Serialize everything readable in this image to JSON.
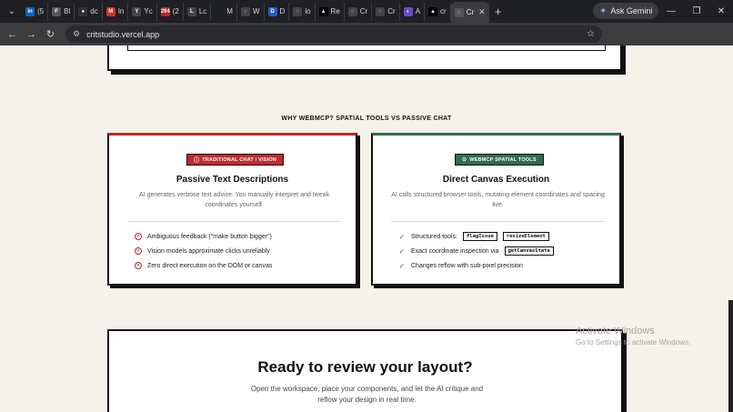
{
  "browser": {
    "tabs": [
      {
        "icon": "linkedin-icon",
        "glyph": "in",
        "color": "#0a66c2",
        "label": "(5"
      },
      {
        "icon": "page-icon",
        "glyph": "F",
        "color": "#555",
        "label": "Bl"
      },
      {
        "icon": "github-icon",
        "glyph": "●",
        "color": "#333",
        "label": "dc"
      },
      {
        "icon": "gmail-icon",
        "glyph": "M",
        "color": "#d93025",
        "label": "In"
      },
      {
        "icon": "page-icon",
        "glyph": "Y",
        "color": "#444",
        "label": "Yc"
      },
      {
        "icon": "badge-icon",
        "glyph": "294",
        "color": "#c5221f",
        "label": "(2"
      },
      {
        "icon": "page-icon",
        "glyph": "L",
        "color": "#444",
        "label": "Lc"
      },
      {
        "icon": "page-icon",
        "glyph": "",
        "color": "#1f2023",
        "label": "M"
      },
      {
        "icon": "globe-icon",
        "glyph": "◌",
        "color": "#444",
        "label": "W"
      },
      {
        "icon": "page-icon",
        "glyph": "D",
        "color": "#2b59c3",
        "label": "D"
      },
      {
        "icon": "globe-icon",
        "glyph": "◌",
        "color": "#444",
        "label": "lo"
      },
      {
        "icon": "vercel-icon",
        "glyph": "▲",
        "color": "#000",
        "label": "Re"
      },
      {
        "icon": "globe-icon",
        "glyph": "◌",
        "color": "#444",
        "label": "Cr"
      },
      {
        "icon": "globe-icon",
        "glyph": "◌",
        "color": "#444",
        "label": "Cr"
      },
      {
        "icon": "page-icon",
        "glyph": "◐",
        "color": "#6a4bc4",
        "label": "A"
      },
      {
        "icon": "vercel-icon",
        "glyph": "▲",
        "color": "#000",
        "label": "cr"
      }
    ],
    "active_tab": {
      "label": "Cr",
      "close": "✕"
    },
    "new_tab": "+",
    "gemini_label": "Ask Gemini",
    "window": {
      "minimize": "—",
      "maximize": "❐",
      "close": "✕"
    },
    "url": "critstudio.vercel.app",
    "nav": {
      "back": "←",
      "forward": "→",
      "reload": "↻"
    }
  },
  "page": {
    "section_label": "WHY WEBMCP? SPATIAL TOOLS VS PASSIVE CHAT",
    "left_card": {
      "badge": "TRADITIONAL CHAT / VISION",
      "title": "Passive Text Descriptions",
      "desc": "AI generates verbose text advice. You manually interpret and tweak coordinates yourself.",
      "items": [
        "Ambiguous feedback (\"make button bigger\")",
        "Vision models approximate clicks unreliably",
        "Zero direct execution on the DOM or canvas"
      ]
    },
    "right_card": {
      "badge": "WEBMCP SPATIAL TOOLS",
      "title": "Direct Canvas Execution",
      "desc": "AI calls structured browser tools, mutating element coordinates and spacing live.",
      "item1_prefix": "Structured tools:",
      "item1_code_a": "flagIssue",
      "item1_code_b": "resizeElement",
      "item2_prefix": "Exact coordinate inspection via",
      "item2_code": "getCanvasState",
      "item3": "Changes reflow with sub-pixel precision"
    },
    "cta": {
      "title": "Ready to review your layout?",
      "desc": "Open the workspace, place your components, and let the AI critique and reflow your design in real time."
    }
  },
  "os_overlay": {
    "line1": "Activate Windows",
    "line2": "Go to Settings to activate Windows."
  },
  "colors": {
    "accent_red": "#c0262d",
    "accent_green": "#2e6d4a",
    "page_bg": "#f5f2ea"
  }
}
